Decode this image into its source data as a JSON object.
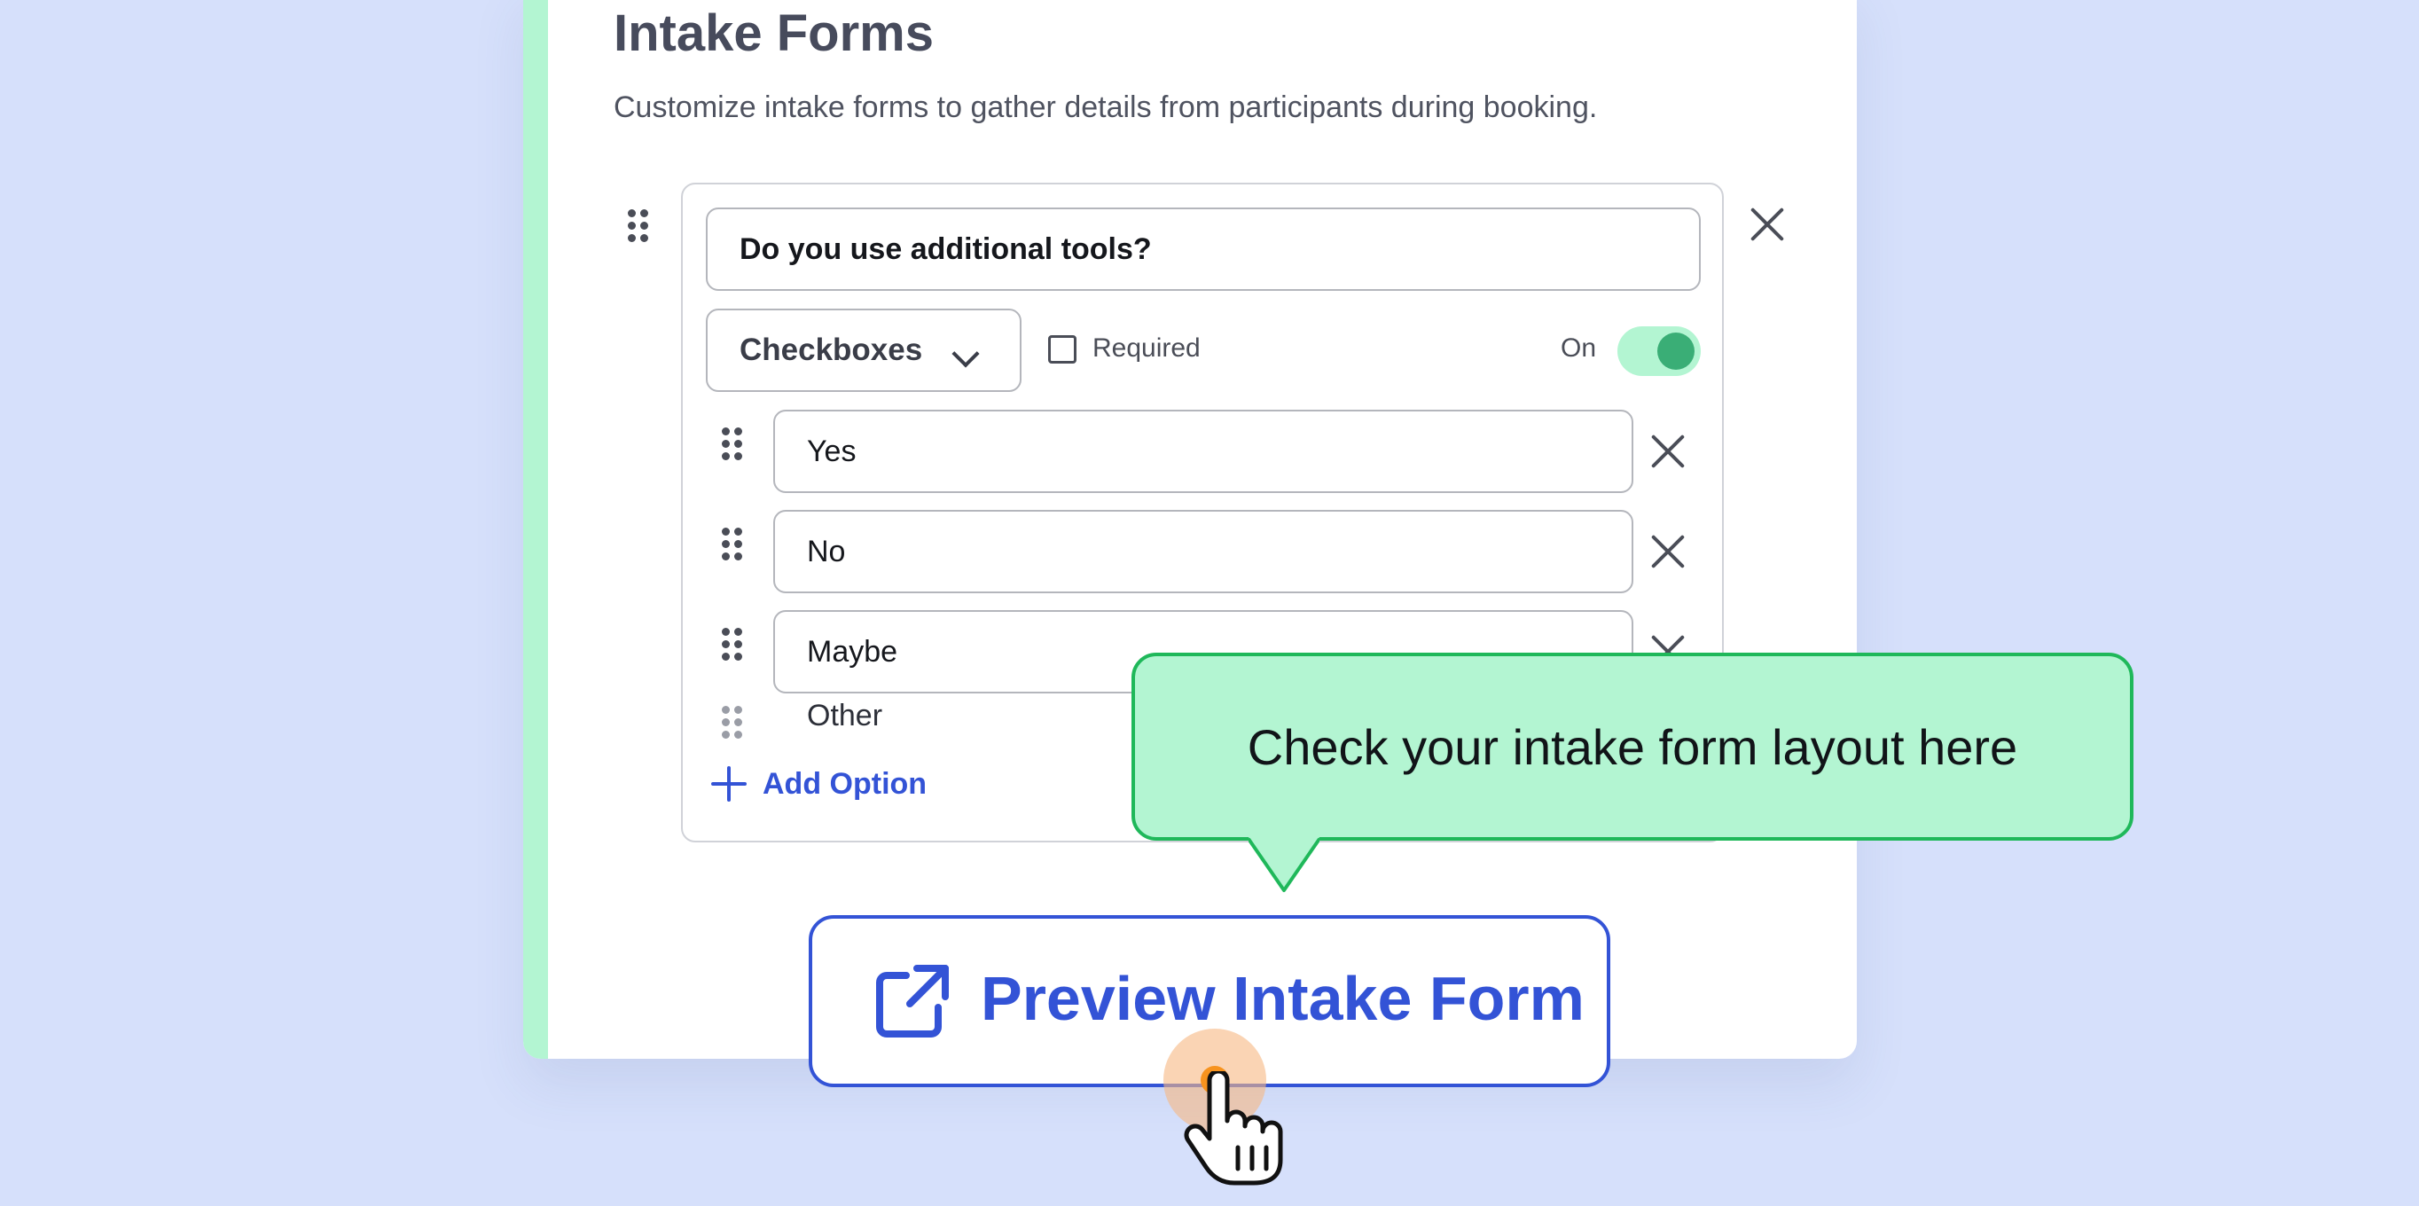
{
  "section": {
    "title": "Intake Forms",
    "description": "Customize intake forms to gather details from participants during booking."
  },
  "question": {
    "text": "Do you use additional tools?",
    "type_select": "Checkboxes",
    "required_label": "Required",
    "required_checked": false,
    "toggle_label": "On",
    "toggle_on": true,
    "options": [
      "Yes",
      "No",
      "Maybe"
    ],
    "other_label": "Other",
    "add_option_label": "Add Option"
  },
  "preview_button": {
    "label": "Preview Intake Form",
    "icon": "external-link-icon"
  },
  "tooltip": {
    "text": "Check your intake form layout here"
  },
  "colors": {
    "accent_blue": "#3353d6",
    "accent_green": "#b3f5d2",
    "toggle_green": "#3aae76",
    "background": "#d6e0fb"
  }
}
